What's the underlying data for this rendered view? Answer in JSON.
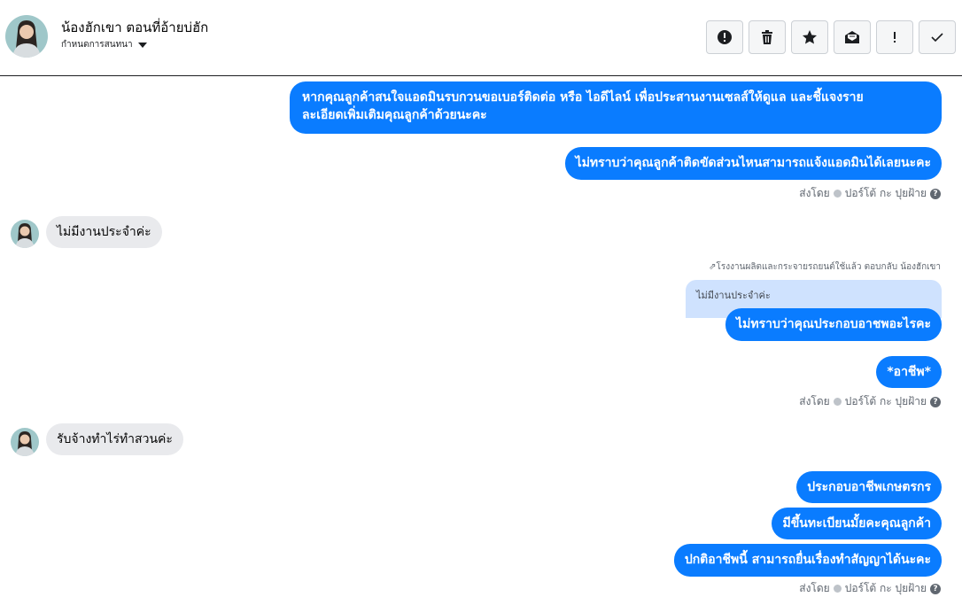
{
  "header": {
    "contact_name": "น้องฮักเขา ตอนที่อ้ายบ่ฮัก",
    "thread_label": "กำหนดการสนทนา",
    "toolbar": [
      {
        "icon": "alert-circle-icon",
        "name": "mark-spam-button"
      },
      {
        "icon": "trash-icon",
        "name": "delete-button"
      },
      {
        "icon": "star-icon",
        "name": "star-button"
      },
      {
        "icon": "mark-unread-icon",
        "name": "mark-unread-button"
      },
      {
        "icon": "exclamation-icon",
        "name": "follow-up-button"
      },
      {
        "icon": "checkmark-icon",
        "name": "mark-done-button"
      }
    ]
  },
  "messages": {
    "m1": "หากคุณลูกค้าสนใจแอดมินรบกวนขอเบอร์ติดต่อ หรือ ไอดีไลน์ เพื่อประสานงานเซลส์ให้ดูแล และชี้แจงราย",
    "m1b": "ละเอียดเพิ่มเติมคุณลูกค้าด้วยนะคะ",
    "m2": "ไม่ทราบว่าคุณลูกค้าติดขัดส่วนไหนสามารถแจ้งแอดมินได้เลยนะคะ",
    "in1": "ไม่มีงานประจำค่ะ",
    "reply_note": "โรงงานผลิตและกระจายรถยนต์ใช้แล้ว ตอบกลับ น้องฮักเขา",
    "quoted": "ไม่มีงานประจำค่ะ",
    "m3": "ไม่ทราบว่าคุณประกอบอาชพอะไรคะ",
    "m4": "*อาชีพ*",
    "in2": "รับจ้างทำไร่ทำสวนค่ะ",
    "m5": "ประกอบอาชีพเกษตรกร",
    "m6": "มีขึ้นทะเบียนมั้ยคะคุณลูกค้า",
    "m7": "ปกติอาชีพนี้ สามารถยื่นเรื่องทำสัญญาได้นะคะ"
  },
  "sent_by": {
    "prefix": "ส่งโดย",
    "agent": "ปอร์โต้ กะ ปุยฝ้าย",
    "help": "?"
  },
  "colors": {
    "outgoing_bubble": "#0a7cff",
    "incoming_bubble": "#e9eaed",
    "quoted_bg": "#cfe2fe"
  }
}
